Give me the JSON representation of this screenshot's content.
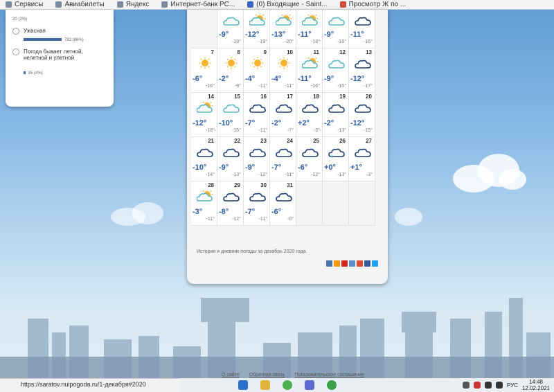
{
  "bookmarks": [
    "Сервисы",
    "Авиабилеты",
    "Яндекс",
    "Интернет-банк РС...",
    "(0) Входящие - Saint...",
    "Просмотр Ж по ..."
  ],
  "poll": {
    "top_count": "20 (2%)",
    "options": [
      {
        "label": "Ужасная",
        "count": "782 (86%)",
        "fill": 0.86
      },
      {
        "label": "Погода бывает летной, нелетной и улетной",
        "count": "35 (4%)",
        "fill": 0.04
      }
    ]
  },
  "calendar": {
    "row0": [
      {
        "day": "",
        "icon": "cloud-sun-icon",
        "t": "-9°",
        "n": "-19°"
      },
      {
        "day": "",
        "icon": "sun-cloud-icon",
        "t": "-12°",
        "n": "-19°"
      },
      {
        "day": "",
        "icon": "sun-cloud-icon",
        "t": "-13°",
        "n": "-20°"
      },
      {
        "day": "",
        "icon": "sun-cloud-icon",
        "t": "-11°",
        "n": "-18°"
      },
      {
        "day": "",
        "icon": "cloud-sun-icon",
        "t": "-9°",
        "n": "-16°"
      },
      {
        "day": "",
        "icon": "cloud-icon",
        "t": "-11°",
        "n": "-16°"
      }
    ],
    "rows": [
      [
        {
          "day": "7",
          "icon": "sun-icon",
          "t": "-6°",
          "n": "-16°"
        },
        {
          "day": "8",
          "icon": "sun-icon",
          "t": "-2°",
          "n": "-9°"
        },
        {
          "day": "9",
          "icon": "sun-icon",
          "t": "-4°",
          "n": "-11°"
        },
        {
          "day": "10",
          "icon": "sun-icon",
          "t": "-4°",
          "n": "-11°"
        },
        {
          "day": "11",
          "icon": "sun-cloud-icon",
          "t": "-11°",
          "n": "-16°"
        },
        {
          "day": "12",
          "icon": "cloud-sun-icon",
          "t": "-9°",
          "n": "-15°"
        },
        {
          "day": "13",
          "icon": "cloud-icon",
          "t": "-12°",
          "n": "-17°"
        }
      ],
      [
        {
          "day": "14",
          "icon": "sun-cloud-icon",
          "t": "-12°",
          "n": "-18°"
        },
        {
          "day": "15",
          "icon": "cloud-sun-icon",
          "t": "-10°",
          "n": "-15°"
        },
        {
          "day": "16",
          "icon": "cloud-icon",
          "t": "-7°",
          "n": "-11°"
        },
        {
          "day": "17",
          "icon": "cloud-icon",
          "t": "-2°",
          "n": "-7°"
        },
        {
          "day": "18",
          "icon": "cloud-icon",
          "t": "+2°",
          "n": "-3°"
        },
        {
          "day": "19",
          "icon": "cloud-icon",
          "t": "-2°",
          "n": "-13°"
        },
        {
          "day": "20",
          "icon": "cloud-icon",
          "t": "-12°",
          "n": "-15°"
        }
      ],
      [
        {
          "day": "21",
          "icon": "cloud-icon",
          "t": "-10°",
          "n": "-14°"
        },
        {
          "day": "22",
          "icon": "cloud-icon",
          "t": "-9°",
          "n": "-13°"
        },
        {
          "day": "23",
          "icon": "cloud-icon",
          "t": "-9°",
          "n": "-12°"
        },
        {
          "day": "24",
          "icon": "cloud-icon",
          "t": "-7°",
          "n": "-11°"
        },
        {
          "day": "25",
          "icon": "cloud-icon",
          "t": "-6°",
          "n": "-12°"
        },
        {
          "day": "26",
          "icon": "cloud-snow-icon",
          "t": "+0°",
          "n": "-13°"
        },
        {
          "day": "27",
          "icon": "cloud-icon",
          "t": "+1°",
          "n": "-3°"
        }
      ],
      [
        {
          "day": "28",
          "icon": "sun-cloud-icon",
          "t": "-3°",
          "n": "-11°"
        },
        {
          "day": "29",
          "icon": "cloud-icon",
          "t": "-8°",
          "n": "-12°"
        },
        {
          "day": "30",
          "icon": "cloud-icon",
          "t": "-7°",
          "n": "-11°"
        },
        {
          "day": "31",
          "icon": "cloud-icon",
          "t": "-6°",
          "n": "-8°"
        },
        {
          "day": "",
          "icon": "",
          "t": "",
          "n": ""
        },
        {
          "day": "",
          "icon": "",
          "t": "",
          "n": ""
        },
        {
          "day": "",
          "icon": "",
          "t": "",
          "n": ""
        }
      ]
    ],
    "description": "История и дневник погоды за декабрь 2020 года."
  },
  "footer": [
    "О сайте",
    "Обратная связь",
    "Пользовательское соглашение"
  ],
  "status_url": "https://saratov.nuipogoda.ru/1-декабря#2020",
  "tray": {
    "lang": "РУС",
    "time": "14:48",
    "date": "12.02.2021"
  }
}
